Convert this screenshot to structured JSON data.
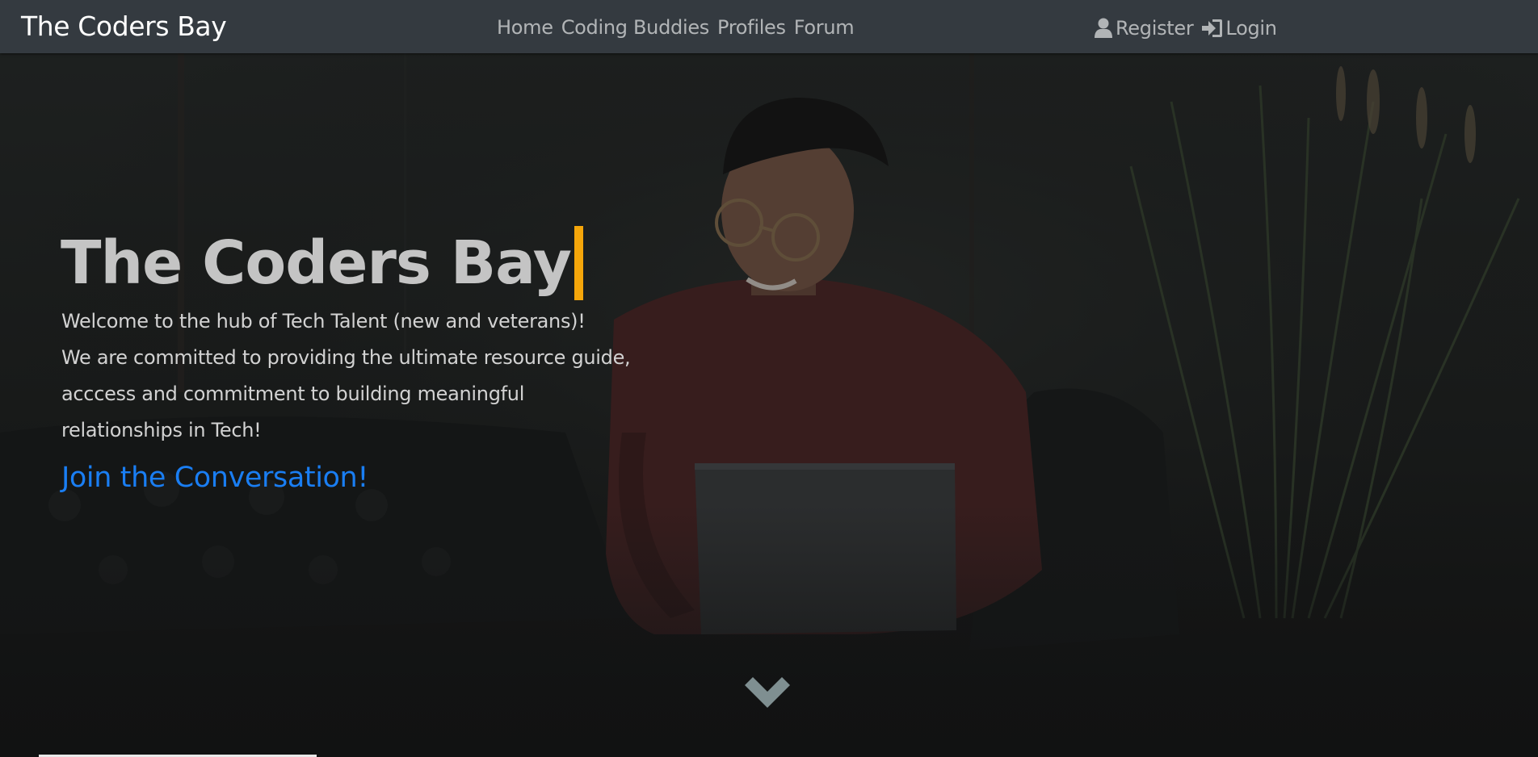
{
  "navbar": {
    "brand": "The Coders Bay",
    "links": [
      {
        "label": "Home"
      },
      {
        "label": "Coding Buddies"
      },
      {
        "label": "Profiles"
      },
      {
        "label": "Forum"
      }
    ],
    "auth": {
      "register": {
        "label": "Register",
        "icon": "user-icon"
      },
      "login": {
        "label": "Login",
        "icon": "sign-in-icon"
      }
    }
  },
  "hero": {
    "title": "The Coders Bay",
    "lines": [
      "Welcome to the hub of Tech Talent (new and veterans)!",
      "We are committed to providing the ultimate resource guide,",
      "acccess and commitment to building meaningful",
      "relationships in Tech!"
    ],
    "cta": "Join the Conversation!",
    "scroll_icon": "chevron-down-icon"
  },
  "colors": {
    "navbar_bg": "#343a40",
    "caret": "#f5a60a",
    "cta": "#1a7ef3",
    "hero_title": "#c4c4c4"
  }
}
